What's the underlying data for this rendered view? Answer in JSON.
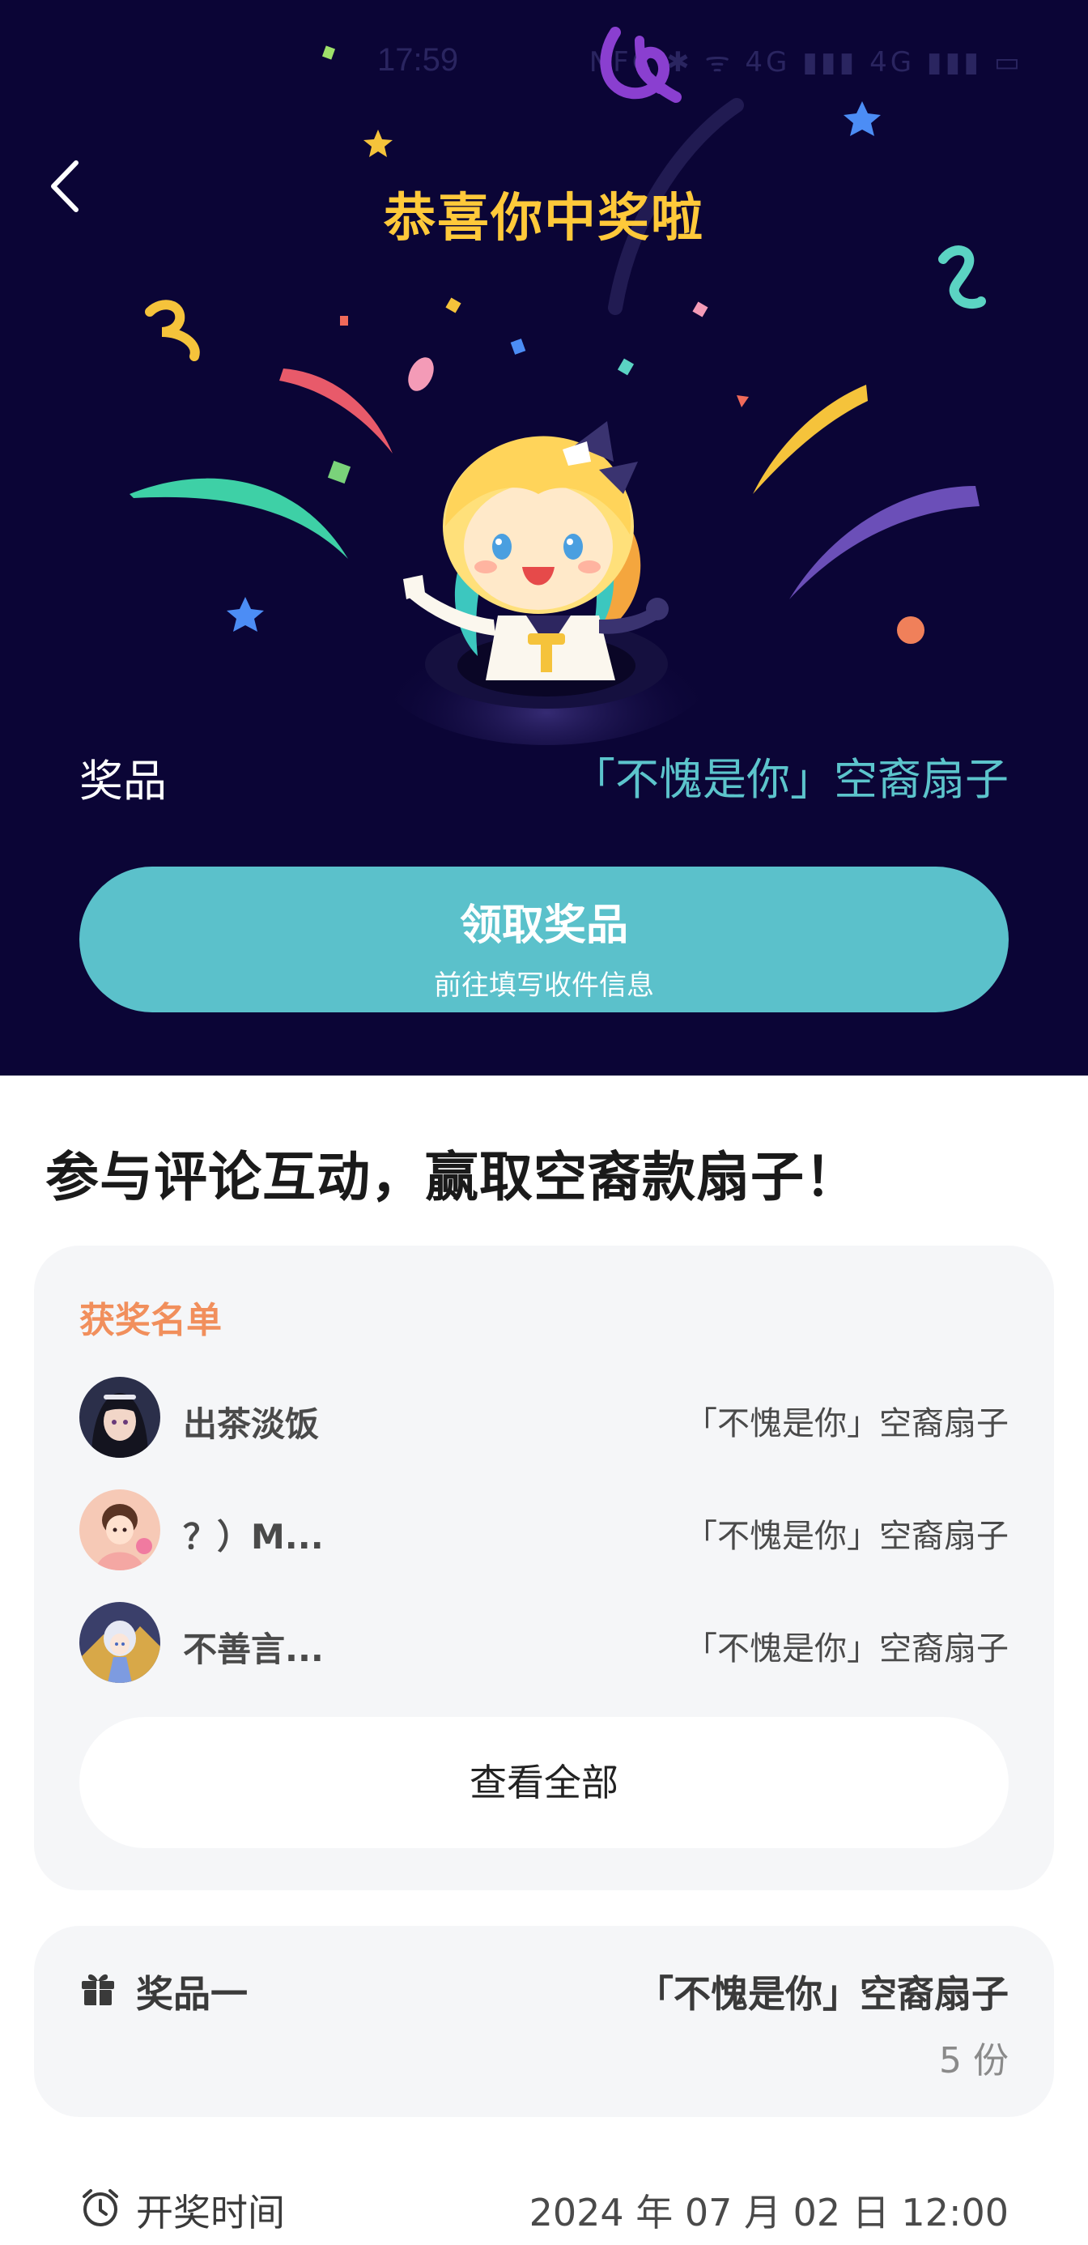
{
  "status_bar": {
    "time": "17:59",
    "icons": "NFC ✱ ᯤ 4G ▮▮▮ 4G ▮▮▮ ▭"
  },
  "hero": {
    "title": "恭喜你中奖啦",
    "prize_label": "奖品",
    "prize_value": "「不愧是你」空裔扇子",
    "claim_button": {
      "title": "领取奖品",
      "subtitle": "前往填写收件信息"
    }
  },
  "headline": "参与评论互动，赢取空裔款扇子！",
  "winners": {
    "heading": "获奖名单",
    "rows": [
      {
        "name": "出茶淡饭",
        "prize": "「不愧是你」空裔扇子"
      },
      {
        "name": "？）M...",
        "prize": "「不愧是你」空裔扇子"
      },
      {
        "name": "不善言...",
        "prize": "「不愧是你」空裔扇子"
      }
    ],
    "view_all_label": "查看全部"
  },
  "prize_card": {
    "label": "奖品一",
    "value": "「不愧是你」空裔扇子",
    "count": "5 份"
  },
  "draw_time": {
    "label": "开奖时间",
    "value": "2024 年 07 月 02 日 12:00"
  },
  "colors": {
    "hero_bg": "#0b0536",
    "title_gold": "#ffc93a",
    "accent_teal": "#5bc1cb",
    "winners_orange": "#f18f5c"
  },
  "icons": {
    "back": "chevron-left-icon",
    "gift": "gift-icon",
    "clock": "alarm-clock-icon"
  }
}
